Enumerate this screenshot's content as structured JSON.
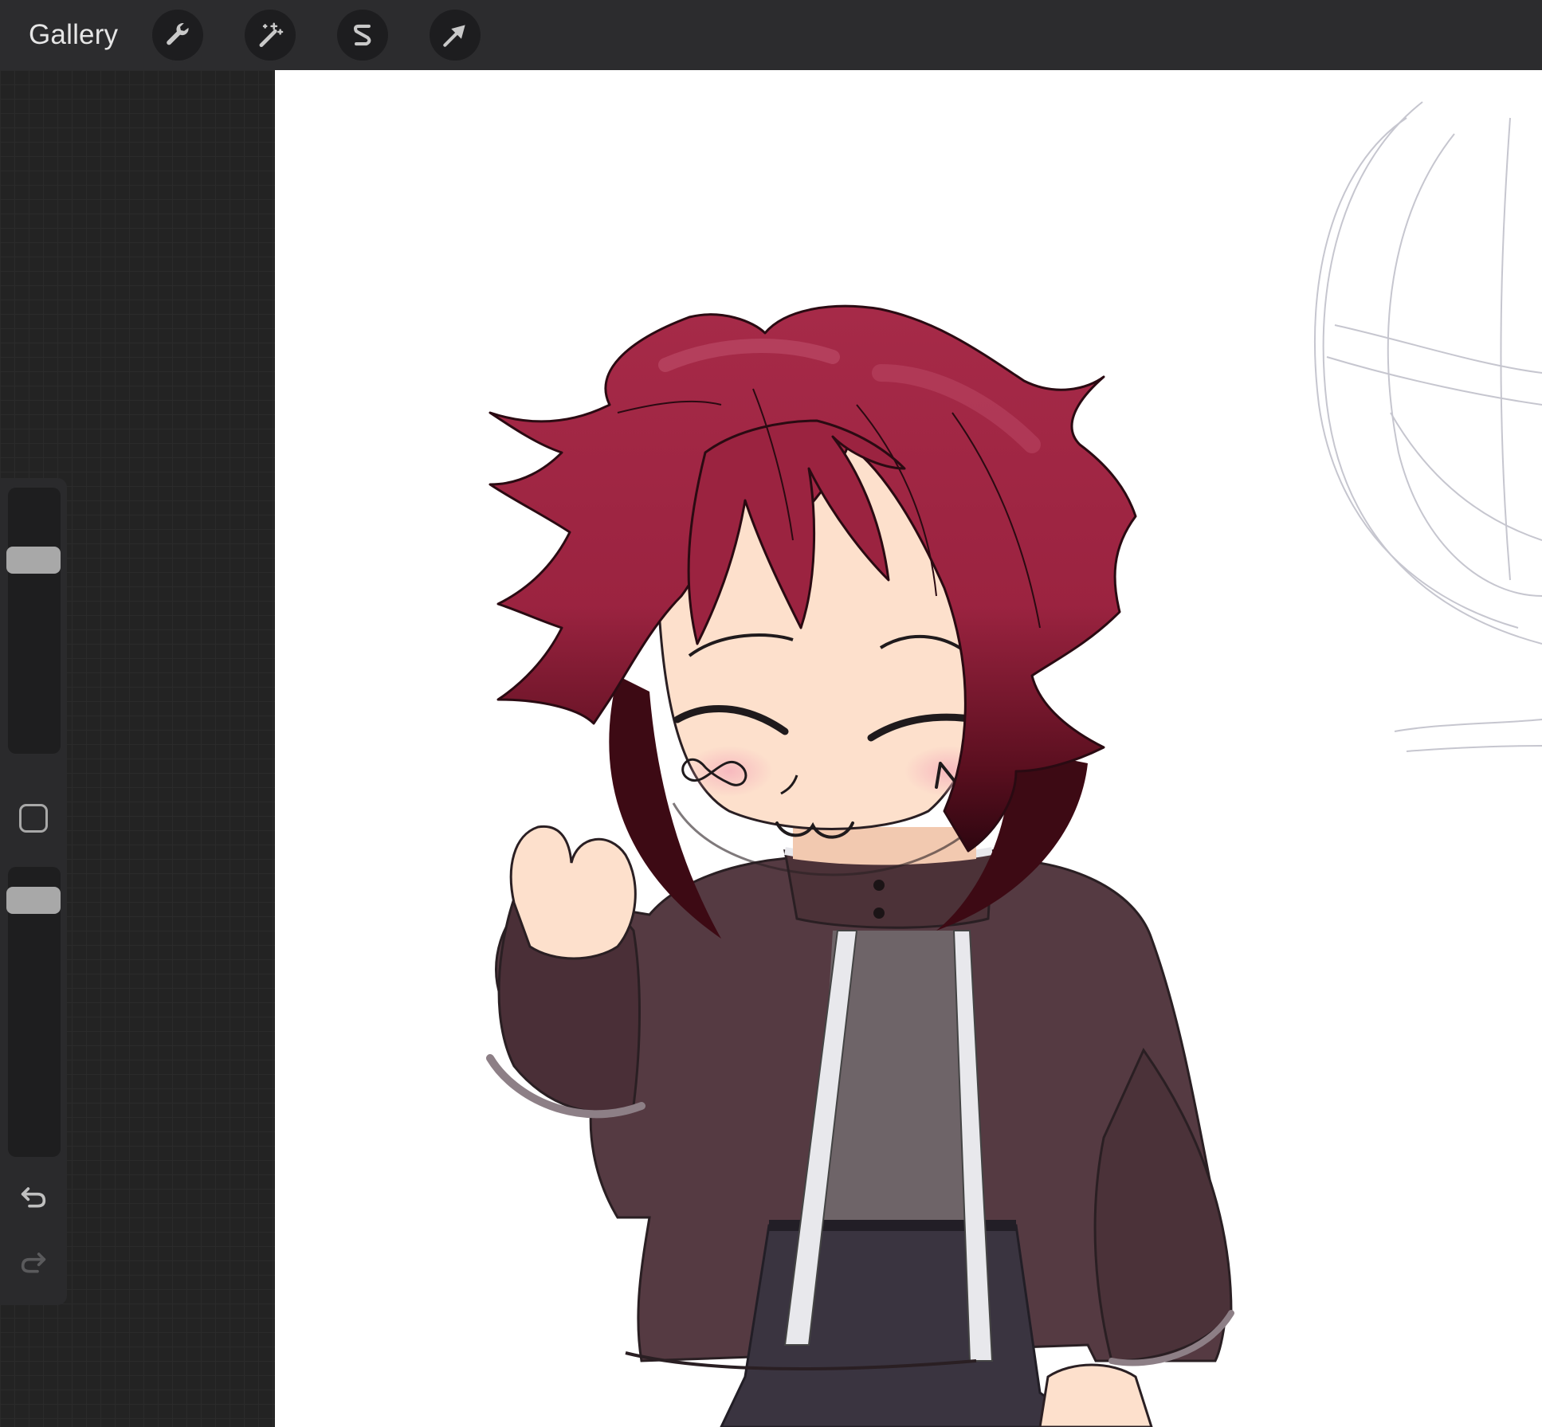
{
  "toolbar": {
    "gallery_label": "Gallery",
    "tools": [
      {
        "name": "actions",
        "icon": "wrench-icon"
      },
      {
        "name": "adjustments",
        "icon": "magic-wand-icon"
      },
      {
        "name": "selection",
        "icon": "selection-s-icon"
      },
      {
        "name": "transform",
        "icon": "arrow-cursor-icon"
      }
    ]
  },
  "sidebar": {
    "brush_size_icon": "size-slider",
    "modify_icon": "square-icon",
    "opacity_icon": "opacity-slider",
    "undo_icon": "undo-icon",
    "redo_icon": "redo-icon",
    "brush_size_level": 0.9,
    "opacity_level": 0.9
  },
  "canvas": {
    "artwork": "chibi-character-drawing",
    "colors": {
      "hair": "#9b2340",
      "hair_dark": "#3d0a14",
      "skin": "#fde0cc",
      "jacket": "#553a42",
      "shirt": "#6e6468",
      "trim": "#e8e8ec",
      "pants": "#3a3440"
    }
  }
}
